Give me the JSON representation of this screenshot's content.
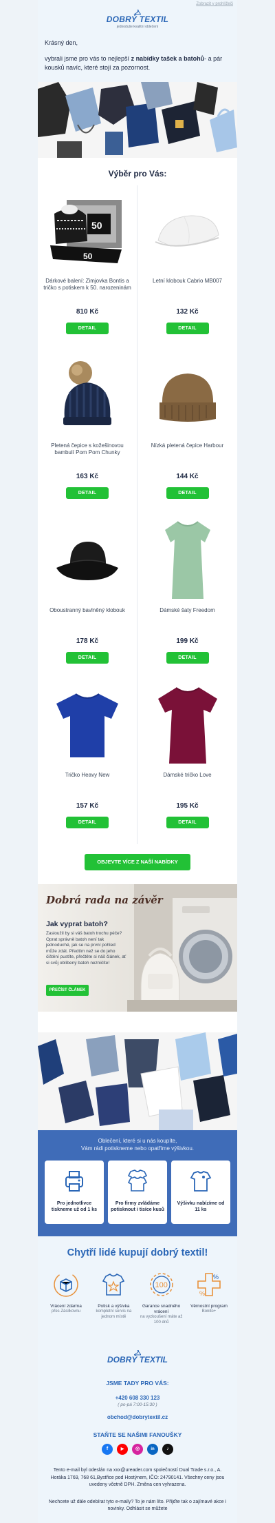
{
  "header": {
    "browser_link": "Zobrazit v prohlížeči",
    "logo_text": "DOBRÝ TEXTIL",
    "logo_tagline": "jednoduše kvalitní oblečení"
  },
  "intro": {
    "greeting": "Krásný den,",
    "text_before": "vybrali jsme pro vás to nejlepší ",
    "text_bold": "z nabídky tašek a batohů",
    "text_after": "- a pár kousků navíc, které stojí za pozornost."
  },
  "products": {
    "title": "Výběr pro Vás:",
    "button_label": "DETAIL",
    "items": [
      {
        "name": "Dárkové balení: Zimjovka Bontis a tričko s potiskem k 50. narozeninám",
        "price": "810 Kč"
      },
      {
        "name": "Letní klobouk Cabrio MB007",
        "price": "132 Kč"
      },
      {
        "name": "Pletená čepice s kožešinovou bambulí Pom Pom Chunky",
        "price": "163 Kč"
      },
      {
        "name": "Nízká pletená čepice Harbour",
        "price": "144 Kč"
      },
      {
        "name": "Oboustranný bavlněný klobouk",
        "price": "178 Kč"
      },
      {
        "name": "Dámské šaty Freedom",
        "price": "199 Kč"
      },
      {
        "name": "Tričko Heavy New",
        "price": "157 Kč"
      },
      {
        "name": "Dámské tričko Love",
        "price": "195 Kč"
      }
    ],
    "more_button": "OBJEVTE VÍCE Z NAŠÍ NABÍDKY"
  },
  "advice": {
    "title": "Dobrá rada na závěr",
    "heading": "Jak vyprat batoh?",
    "text": "Zasloužil by si váš batoh trochu péče? Oprat správně batoh není tak jednoduché, jak se na první pohled může zdát. Předtím než se do jeho čištění pustíte, přečtěte si náš článek, ať si svůj oblíbený batoh nezničíte!",
    "button": "PŘEČÍST ČLÁNEK"
  },
  "print": {
    "line1": "Oblečení, které si u nás koupíte,",
    "line2": "Vám rádi potiskneme nebo opatříme výšivkou.",
    "cards": [
      {
        "label": "Pro jednotlivce tiskneme už od 1 ks",
        "icon": "printer-icon"
      },
      {
        "label": "Pro firmy zvládáme potisknout i tisíce kusů",
        "icon": "stacked-shirts-icon"
      },
      {
        "label": "Výšivku nabízíme od 11 ks",
        "icon": "tshirt-icon"
      }
    ]
  },
  "smart": {
    "title": "Chytří lidé kupují dobrý textil!",
    "features": [
      {
        "title": "Vrácení zdarma",
        "sub": "přes Zásilkovnu",
        "icon": "return-box-icon"
      },
      {
        "title": "Potisk a výšivka",
        "sub": "kompletní servis na jednom místě",
        "icon": "tshirt-star-icon"
      },
      {
        "title": "Garance snadného vrácení",
        "sub": "na vyzkoušení máte až 100 dnů",
        "icon": "hundred-days-icon"
      },
      {
        "title": "Věrnostní program",
        "sub": "Bonito+",
        "icon": "loyalty-plus-icon"
      }
    ]
  },
  "footer": {
    "logo_text": "DOBRÝ TEXTIL",
    "contact_heading": "JSME TADY PRO VÁS:",
    "phone": "+420 608 330 123",
    "hours": "( po-pá 7:00-15:30 )",
    "email": "obchod@dobrytextil.cz",
    "fans_heading": "STAŇTE SE NAŠIMI FANOUŠKY",
    "socials": [
      {
        "name": "facebook-icon",
        "glyph": "f",
        "color": "#1877f2"
      },
      {
        "name": "youtube-icon",
        "glyph": "▶",
        "color": "#ff0000"
      },
      {
        "name": "instagram-icon",
        "glyph": "◎",
        "color": "#d6249f"
      },
      {
        "name": "linkedin-icon",
        "glyph": "in",
        "color": "#0a66c2"
      },
      {
        "name": "tiktok-icon",
        "glyph": "♪",
        "color": "#111111"
      }
    ],
    "legal": "Tento e-mail byl odeslán na xxx@ureader.com společností Dual Trade s.r.o., A. Horáka 1769, 768 61,Bystřice pod Hostýnem, IČO: 24790141. Všechny ceny jsou uvedeny včetně DPH. Změna cen vyhrazena.",
    "unsubscribe": "Nechcete už dále odebírat tyto e-maily? To je nám líto. Přijďte tak o zajímavé akce i novinky. Odhlásit se můžete"
  },
  "colors": {
    "brand_blue": "#2a66b6",
    "cta_green": "#22c136",
    "band_blue": "#3f6cb8"
  }
}
